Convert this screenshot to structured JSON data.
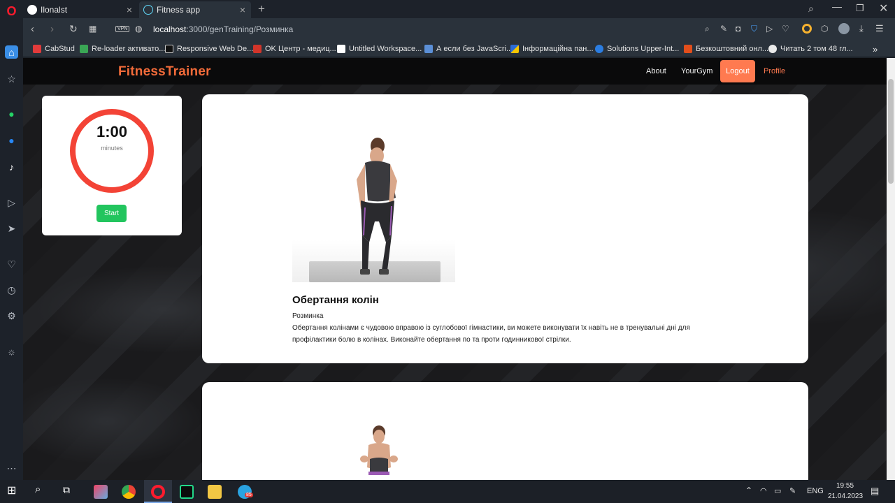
{
  "browser": {
    "tabs": [
      {
        "title": "Ilonalst",
        "icon": "github-icon"
      },
      {
        "title": "Fitness app",
        "icon": "react-icon"
      }
    ],
    "new_tab_symbol": "+",
    "address": {
      "host": "localhost",
      "rest": ":3000/genTraining/Розминка"
    },
    "vpn_label": "VPN",
    "bookmarks": [
      {
        "label": "CabStud",
        "color": "#e23b3b"
      },
      {
        "label": "Re-loader активато...",
        "color": "#3aa655"
      },
      {
        "label": "Responsive Web De...",
        "color": "#111111"
      },
      {
        "label": "OK Центр - медиц...",
        "color": "#d2352a"
      },
      {
        "label": "Untitled Workspace...",
        "color": "#222222"
      },
      {
        "label": "А если без JavaScri...",
        "color": "#5b8fd6"
      },
      {
        "label": "Інформаційна пан...",
        "color": "#f7c600"
      },
      {
        "label": "Solutions Upper-Int...",
        "color": "#2b7de1"
      },
      {
        "label": "Безкоштовний онл...",
        "color": "#e24e1b"
      },
      {
        "label": "Читать 2 том 48 гл...",
        "color": "#eaeaea"
      }
    ],
    "more_bookmarks": "»"
  },
  "app": {
    "logo": "FitnessTrainer",
    "nav": {
      "about": "About",
      "yourgym": "YourGym",
      "logout": "Logout",
      "profile": "Profile"
    },
    "timer": {
      "time": "1:00",
      "unit": "minutes",
      "start": "Start"
    },
    "exercise": {
      "title": "Обертання колін",
      "category": "Розминка",
      "description": "Обертання колінами є чудовою вправою із суглобової гімнастики, ви можете виконувати їх навіть не в тренувальні дні для профілактики болю в колінах. Виконайте обертання по та проти годинникової стрілки."
    }
  },
  "taskbar": {
    "language": "ENG",
    "time": "19:55",
    "date": "21.04.2023",
    "telegram_badge": "85"
  },
  "colors": {
    "brand_orange": "#f26b3a",
    "logout_bg": "#ff7a50",
    "timer_ring": "#f34336",
    "start_green": "#22c55e"
  }
}
